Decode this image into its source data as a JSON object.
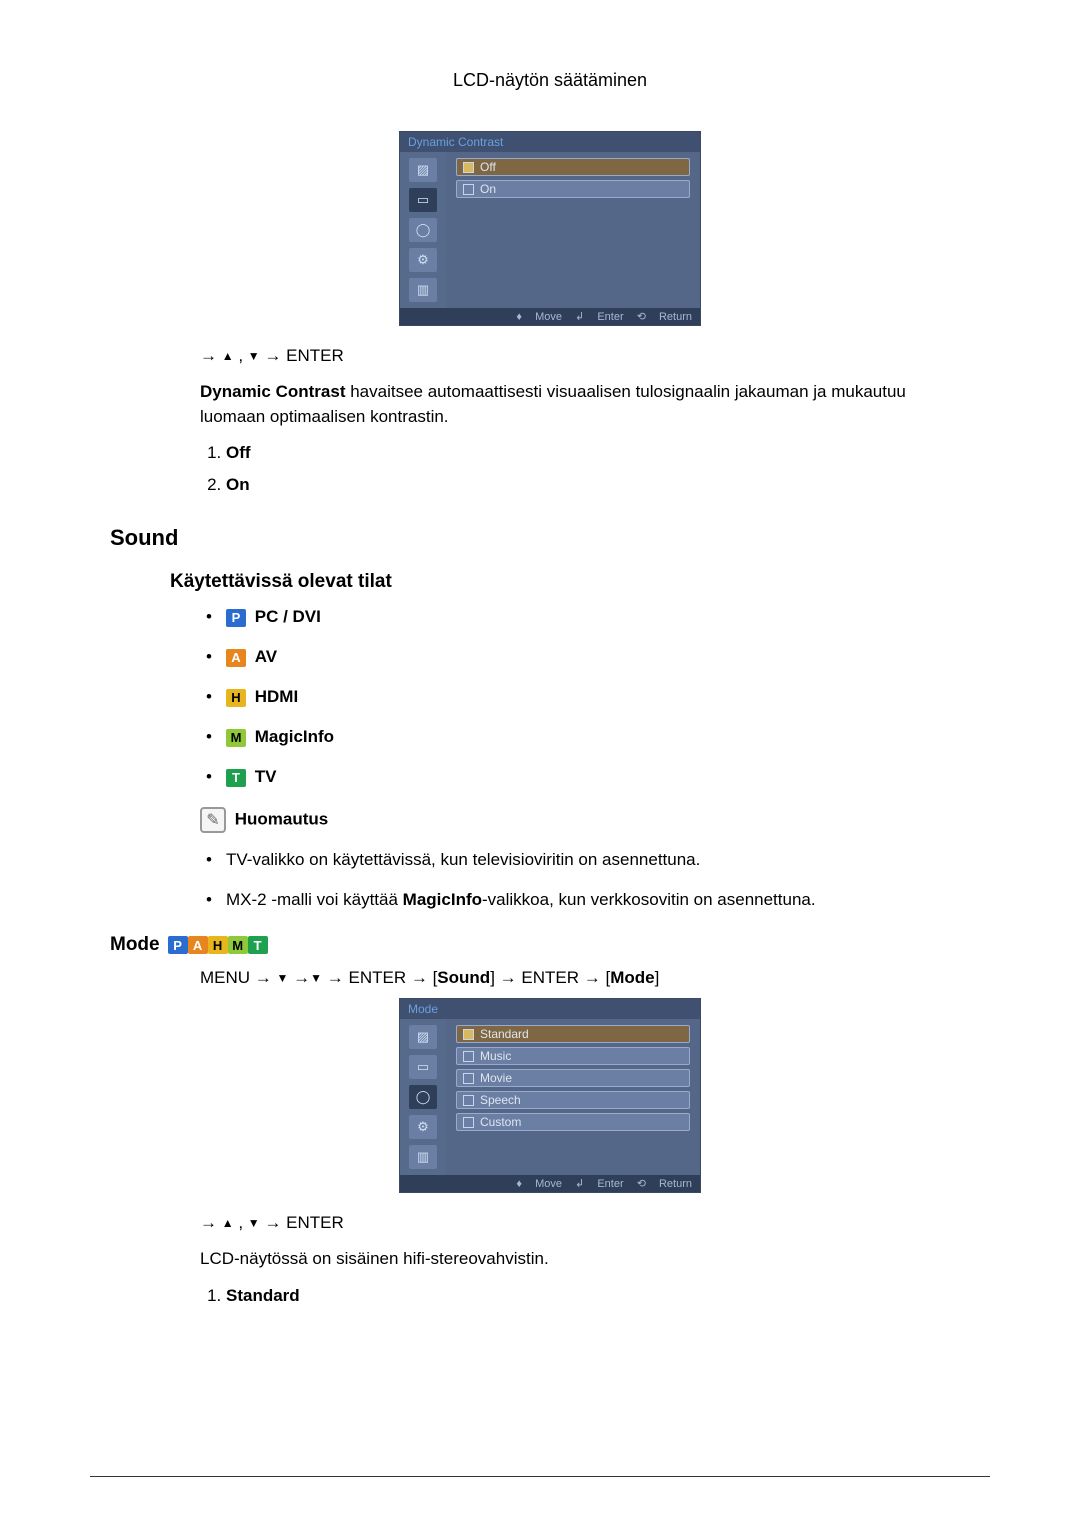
{
  "header": {
    "title": "LCD-näytön säätäminen"
  },
  "osd1": {
    "title": "Dynamic Contrast",
    "options": [
      "Off",
      "On"
    ],
    "selected_index": 0,
    "footer": {
      "move": "Move",
      "enter": "Enter",
      "return": "Return"
    }
  },
  "nav1": {
    "prefix": "→ ",
    "mid": " , ",
    "tail": " → ENTER"
  },
  "dyn_contrast": {
    "bold_lead": "Dynamic Contrast",
    "text_after": " havaitsee automaattisesti visuaalisen tulosignaalin jakauman ja mukautuu luomaan optimaalisen kontrastin.",
    "list": [
      "Off",
      "On"
    ]
  },
  "sound_heading": "Sound",
  "modes_heading": "Käytettävissä olevat tilat",
  "modes": {
    "pc_dvi": "PC / DVI",
    "av": "AV",
    "hdmi": "HDMI",
    "magicinfo": "MagicInfo",
    "tv": "TV"
  },
  "note": {
    "label": "Huomautus",
    "items": [
      "TV-valikko on käytettävissä, kun televisioviritin on asennettuna.",
      "MX-2 -malli voi käyttää MagicInfo-valikkoa, kun verkkosovitin on asennettuna."
    ],
    "item2_pre": "MX-2 -malli voi käyttää ",
    "item2_bold": "MagicInfo",
    "item2_post": "-valikkoa, kun verkkosovitin on asennettuna."
  },
  "mode_heading": "Mode",
  "mode_nav": {
    "menu": "MENU",
    "enter": "ENTER",
    "sound_label": "Sound",
    "mode_label": "Mode"
  },
  "osd2": {
    "title": "Mode",
    "options": [
      "Standard",
      "Music",
      "Movie",
      "Speech",
      "Custom"
    ],
    "selected_index": 0,
    "footer": {
      "move": "Move",
      "enter": "Enter",
      "return": "Return"
    }
  },
  "nav2": {
    "prefix": "→ ",
    "mid": " , ",
    "tail": " → ENTER"
  },
  "mode_text": "LCD-näytössä on sisäinen hifi-stereovahvistin.",
  "mode_list": [
    "Standard"
  ]
}
